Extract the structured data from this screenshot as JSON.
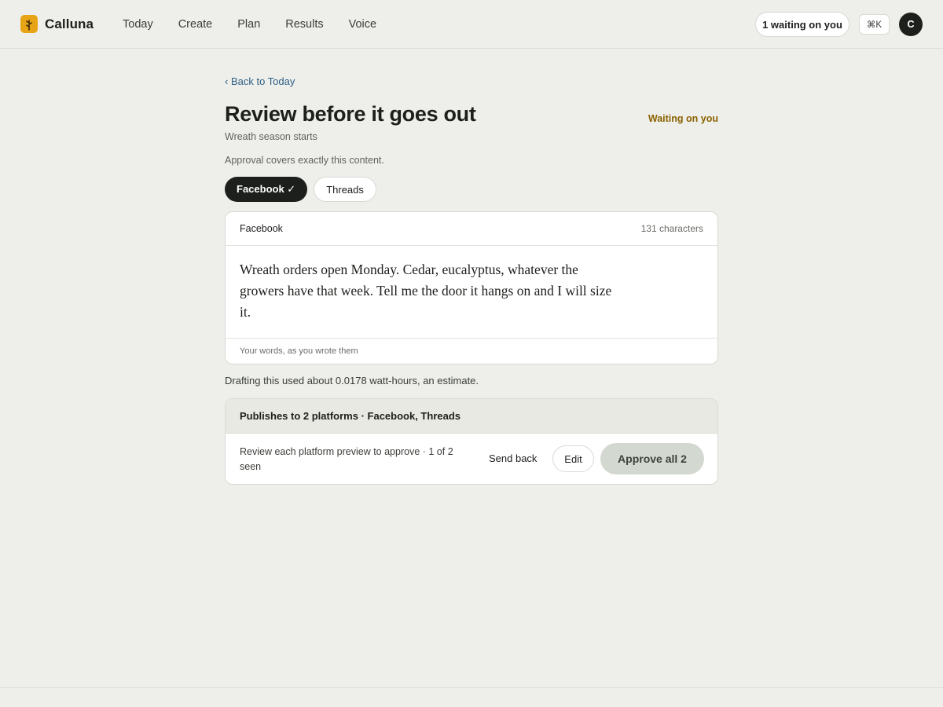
{
  "app": {
    "name": "Calluna",
    "logo_icon": "sprig-icon",
    "brand_color": "#e8a417"
  },
  "nav": {
    "items": [
      {
        "label": "Today"
      },
      {
        "label": "Create"
      },
      {
        "label": "Plan"
      },
      {
        "label": "Results"
      },
      {
        "label": "Voice"
      }
    ]
  },
  "header": {
    "waiting_label": "1 waiting on you",
    "shortcut_label": "⌘K",
    "avatar_initial": "C"
  },
  "page": {
    "back_label": "‹ Back to Today",
    "title": "Review before it goes out",
    "status": "Waiting on you",
    "status_color": "#8a6100",
    "subtitle": "Wreath season starts",
    "approval_note": "Approval covers exactly this content."
  },
  "tabs": [
    {
      "label": "Facebook ✓",
      "active": true
    },
    {
      "label": "Threads",
      "active": false
    }
  ],
  "preview": {
    "platform": "Facebook",
    "char_count": "131 characters",
    "text": "Wreath orders open Monday. Cedar, eucalyptus, whatever the growers have that week. Tell me the door it hangs on and I will size it.",
    "footnote": "Your words, as you wrote them"
  },
  "energy_note": "Drafting this used about 0.0178 watt-hours, an estimate.",
  "publish": {
    "header": "Publishes to 2 platforms · Facebook, Threads",
    "review_text": "Review each platform preview to approve · 1 of 2 seen",
    "send_back_label": "Send back",
    "edit_label": "Edit",
    "approve_label": "Approve all 2"
  }
}
